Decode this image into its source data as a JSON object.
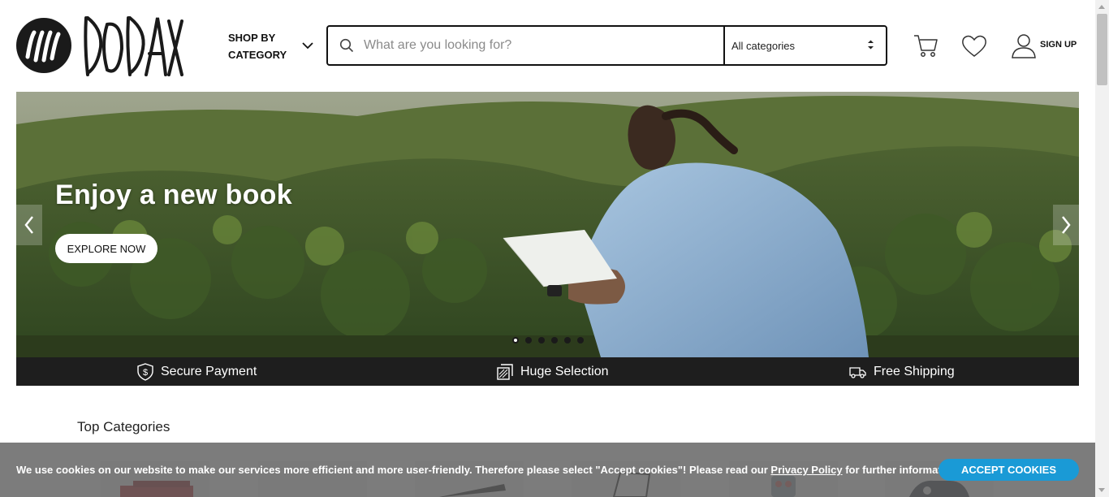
{
  "header": {
    "logo_icon": "dodax-logo-icon",
    "shop_by_label": "SHOP BY CATEGORY",
    "search": {
      "placeholder": "What are you looking for?",
      "value": ""
    },
    "category_select": "All categories",
    "icons": [
      "search-icon",
      "cart-icon",
      "heart-icon",
      "user-icon",
      "chevron-down-icon"
    ],
    "signup_label": "SIGN UP"
  },
  "hero": {
    "title": "Enjoy a new book",
    "cta_label": "EXPLORE NOW",
    "slide_count": 6,
    "active_slide": 1
  },
  "features": [
    {
      "icon": "shield-dollar-icon",
      "label": "Secure Payment"
    },
    {
      "icon": "selection-icon",
      "label": "Huge Selection"
    },
    {
      "icon": "truck-icon",
      "label": "Free Shipping"
    }
  ],
  "top_categories": {
    "title": "Top Categories"
  },
  "cookie_banner": {
    "text_before": "We use cookies on our website to make our services more efficient and more user-friendly. Therefore please select \"Accept cookies\"! Please read our ",
    "link_label": "Privacy Policy",
    "text_after": " for further information.",
    "accept_label": "ACCEPT COOKIES"
  },
  "colors": {
    "accent": "#1a9ad6",
    "feature_bar": "#1e1e1e",
    "text_dark": "#111111"
  }
}
